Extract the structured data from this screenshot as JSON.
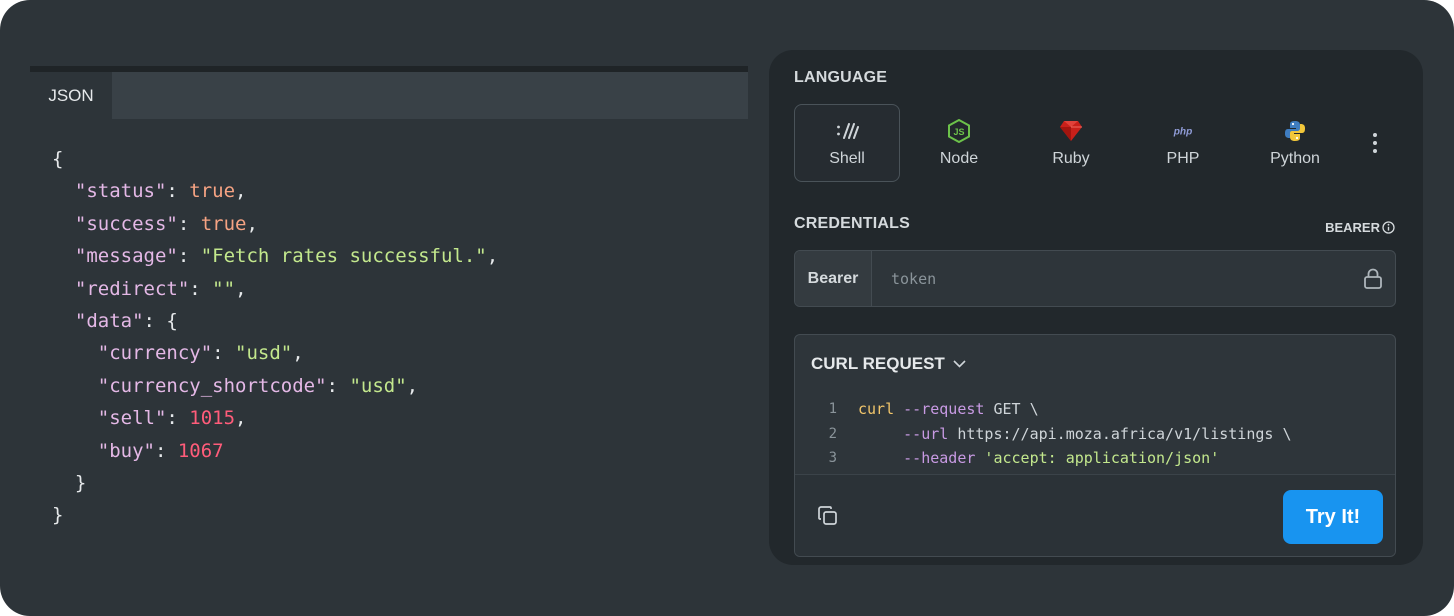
{
  "json_panel": {
    "tab_label": "JSON",
    "lines": [
      [
        {
          "t": "{",
          "c": "p"
        }
      ],
      [
        {
          "t": "  \"status\"",
          "c": "k"
        },
        {
          "t": ": ",
          "c": "p"
        },
        {
          "t": "true",
          "c": "b"
        },
        {
          "t": ",",
          "c": "p"
        }
      ],
      [
        {
          "t": "  \"success\"",
          "c": "k"
        },
        {
          "t": ": ",
          "c": "p"
        },
        {
          "t": "true",
          "c": "b"
        },
        {
          "t": ",",
          "c": "p"
        }
      ],
      [
        {
          "t": "  \"message\"",
          "c": "k"
        },
        {
          "t": ": ",
          "c": "p"
        },
        {
          "t": "\"Fetch rates successful.\"",
          "c": "s"
        },
        {
          "t": ",",
          "c": "p"
        }
      ],
      [
        {
          "t": "  \"redirect\"",
          "c": "k"
        },
        {
          "t": ": ",
          "c": "p"
        },
        {
          "t": "\"\"",
          "c": "s"
        },
        {
          "t": ",",
          "c": "p"
        }
      ],
      [
        {
          "t": "  \"data\"",
          "c": "k"
        },
        {
          "t": ": {",
          "c": "p"
        }
      ],
      [
        {
          "t": "    \"currency\"",
          "c": "k"
        },
        {
          "t": ": ",
          "c": "p"
        },
        {
          "t": "\"usd\"",
          "c": "s"
        },
        {
          "t": ",",
          "c": "p"
        }
      ],
      [
        {
          "t": "    \"currency_shortcode\"",
          "c": "k"
        },
        {
          "t": ": ",
          "c": "p"
        },
        {
          "t": "\"usd\"",
          "c": "s"
        },
        {
          "t": ",",
          "c": "p"
        }
      ],
      [
        {
          "t": "    \"sell\"",
          "c": "k"
        },
        {
          "t": ": ",
          "c": "p"
        },
        {
          "t": "1015",
          "c": "n"
        },
        {
          "t": ",",
          "c": "p"
        }
      ],
      [
        {
          "t": "    \"buy\"",
          "c": "k"
        },
        {
          "t": ": ",
          "c": "p"
        },
        {
          "t": "1067",
          "c": "n"
        }
      ],
      [
        {
          "t": "  }",
          "c": "p"
        }
      ],
      [
        {
          "t": "}",
          "c": "p"
        }
      ]
    ]
  },
  "language": {
    "title": "LANGUAGE",
    "items": [
      {
        "label": "Shell",
        "icon": "shell-icon"
      },
      {
        "label": "Node",
        "icon": "nodejs-icon"
      },
      {
        "label": "Ruby",
        "icon": "ruby-icon"
      },
      {
        "label": "PHP",
        "icon": "php-icon"
      },
      {
        "label": "Python",
        "icon": "python-icon"
      }
    ],
    "selected": "Shell",
    "more_icon": "more-vertical-icon"
  },
  "credentials": {
    "title": "CREDENTIALS",
    "auth_type": "BEARER",
    "label": "Bearer",
    "placeholder": "token",
    "value": ""
  },
  "curl": {
    "title": "CURL REQUEST",
    "lines": [
      {
        "num": "1",
        "parts": [
          {
            "t": "curl",
            "c": "c-cmd"
          },
          {
            "t": " --request",
            "c": "c-flag"
          },
          {
            "t": " GET \\",
            "c": "c-plain"
          }
        ]
      },
      {
        "num": "2",
        "parts": [
          {
            "t": "     --url",
            "c": "c-flag"
          },
          {
            "t": " https://api.moza.africa/v1/listings \\",
            "c": "c-plain"
          }
        ]
      },
      {
        "num": "3",
        "parts": [
          {
            "t": "     --header",
            "c": "c-flag"
          },
          {
            "t": " 'accept: application/json'",
            "c": "c-str"
          }
        ]
      }
    ],
    "copy_icon": "copy-icon",
    "try_label": "Try It!"
  },
  "colors": {
    "background": "#2d3439",
    "card": "#22282c",
    "accent": "#1894f0",
    "json_key": "#e4b8e6",
    "json_string": "#c3e88d",
    "json_bool": "#f6a383",
    "json_number": "#ff5c7a"
  }
}
